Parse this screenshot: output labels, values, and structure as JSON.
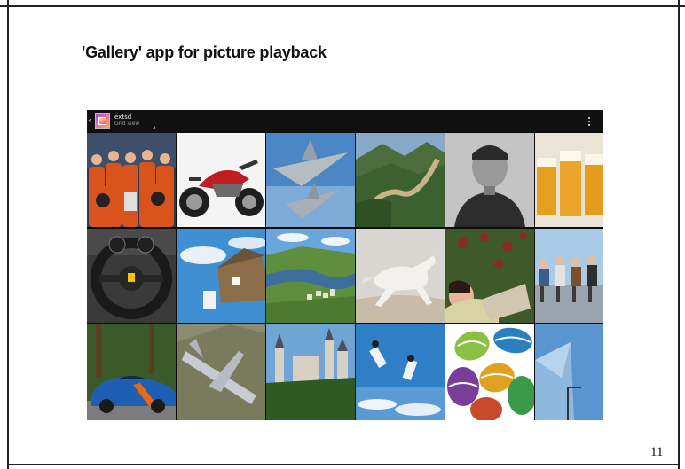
{
  "document": {
    "heading": "'Gallery' app for picture playback",
    "page_number": "11"
  },
  "gallery": {
    "action_bar": {
      "back_icon": "chevron-left-icon",
      "app_icon": "gallery-app-icon",
      "storage_label": "extsd",
      "view_mode": "Grid view",
      "menu_icon": "overflow-menu-icon"
    },
    "thumbnails": [
      {
        "subject": "astronaut-crew"
      },
      {
        "subject": "red-motorcycle"
      },
      {
        "subject": "fighter-jets"
      },
      {
        "subject": "great-wall"
      },
      {
        "subject": "portrait-man"
      },
      {
        "subject": "beer-glasses"
      },
      {
        "subject": "steering-wheel"
      },
      {
        "subject": "flying-house"
      },
      {
        "subject": "river-town"
      },
      {
        "subject": "white-horse"
      },
      {
        "subject": "woman-in-garden"
      },
      {
        "subject": "friends-sitting"
      },
      {
        "subject": "blue-sports-car"
      },
      {
        "subject": "airplane"
      },
      {
        "subject": "castle"
      },
      {
        "subject": "skydivers"
      },
      {
        "subject": "easter-eggs"
      },
      {
        "subject": "glass-building"
      }
    ]
  }
}
